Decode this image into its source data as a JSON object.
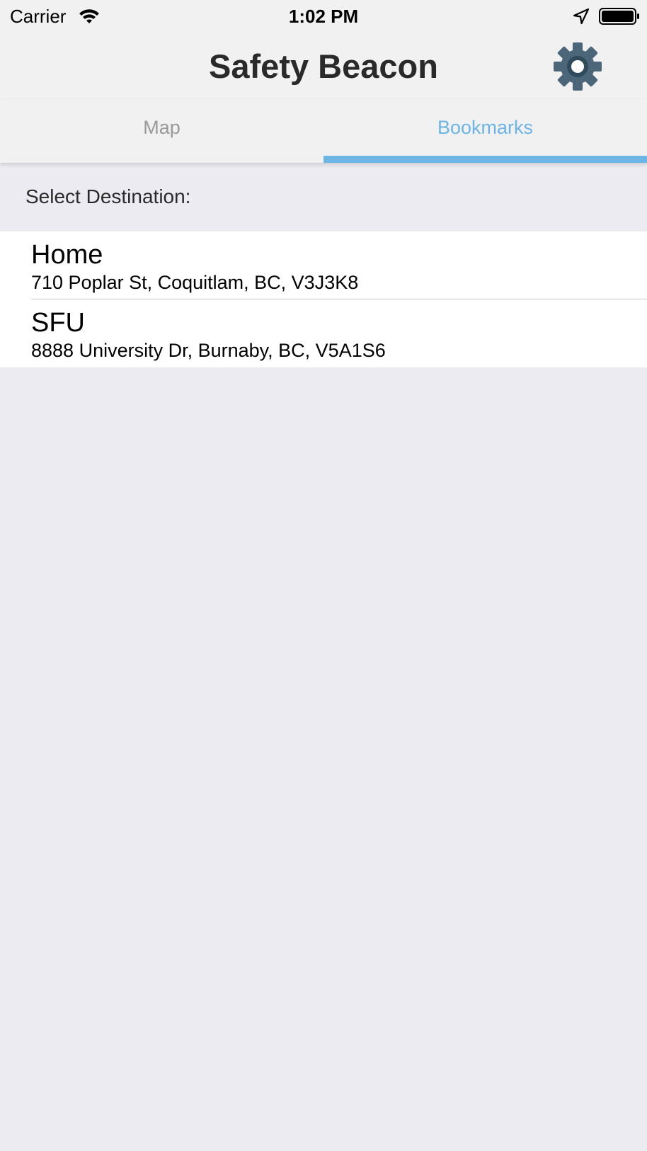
{
  "status_bar": {
    "carrier": "Carrier",
    "time": "1:02 PM",
    "icons": [
      "wifi-icon",
      "location-arrow-icon",
      "battery-icon"
    ]
  },
  "header": {
    "title": "Safety Beacon",
    "settings_icon": "gear-icon"
  },
  "tabs": [
    {
      "label": "Map",
      "active": false
    },
    {
      "label": "Bookmarks",
      "active": true
    }
  ],
  "section_label": "Select Destination:",
  "bookmarks": [
    {
      "name": "Home",
      "address": "710 Poplar St, Coquitlam, BC, V3J3K8"
    },
    {
      "name": "SFU",
      "address": "8888 University Dr, Burnaby, BC, V5A1S6"
    }
  ],
  "colors": {
    "accent": "#6cb5e4",
    "header_bg": "#f1f1f2",
    "page_bg": "#ebebf1",
    "gear": "#4a6678",
    "tab_inactive": "#9a9a9a"
  }
}
